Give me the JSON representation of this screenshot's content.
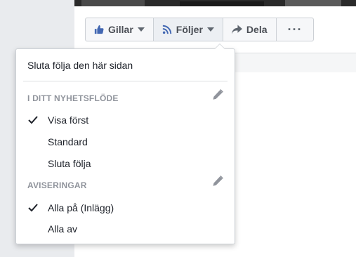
{
  "actions": {
    "like_label": "Gillar",
    "follow_label": "Följer",
    "share_label": "Dela",
    "more_label": "···"
  },
  "dropdown": {
    "unfollow_page": "Sluta följa den här sidan",
    "news_feed_header": "I DITT NYHETSFLÖDE",
    "news_feed_options": [
      "Visa först",
      "Standard",
      "Sluta följa"
    ],
    "news_feed_selected": "Visa först",
    "notifications_header": "AVISERINGAR",
    "notification_options": [
      "Alla på (Inlägg)",
      "Alla av"
    ],
    "notifications_selected": "Alla på (Inlägg)"
  },
  "colors": {
    "accent": "#4267b2",
    "icon_gray": "#606770",
    "header_gray": "#90949c"
  },
  "icons": {
    "like": "thumbs-up-icon",
    "follow": "rss-icon",
    "share": "share-arrow-icon",
    "check": "checkmark-icon",
    "edit": "pencil-icon"
  }
}
